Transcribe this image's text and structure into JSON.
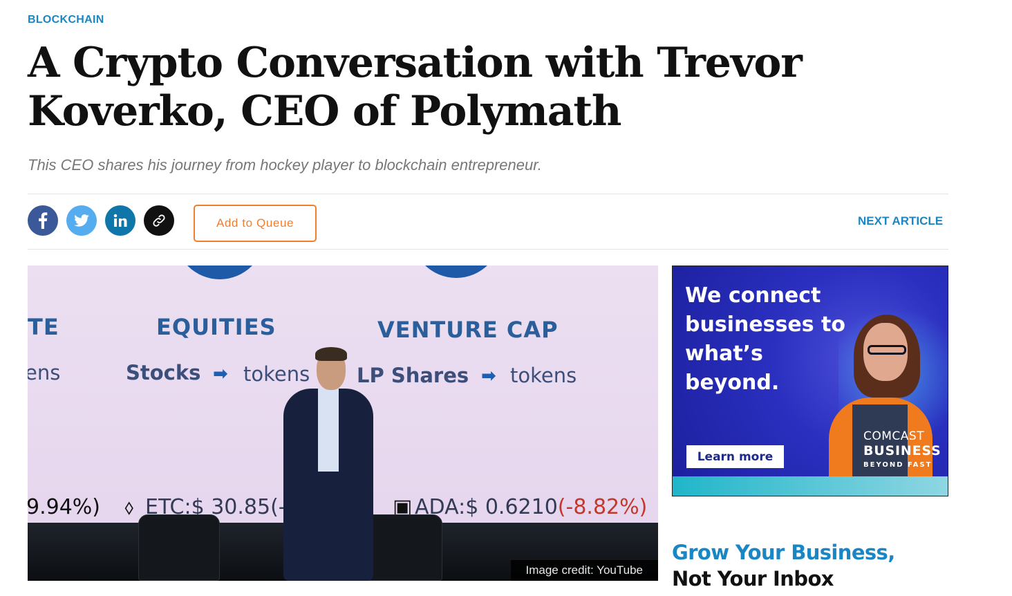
{
  "article": {
    "category": "BLOCKCHAIN",
    "headline": "A Crypto Conversation with Trevor Koverko, CEO of Polymath",
    "dek": "This CEO shares his journey from hockey player to blockchain entrepreneur."
  },
  "toolbar": {
    "share_icons": [
      "facebook-icon",
      "twitter-icon",
      "linkedin-icon",
      "link-icon"
    ],
    "queue_label": "Add to Queue",
    "next_label": "NEXT ARTICLE",
    "colors": {
      "facebook": "#3b5998",
      "twitter": "#55acee",
      "linkedin": "#0e76a8",
      "link": "#111111",
      "queue": "#f07e2f",
      "accent": "#1b86c4"
    }
  },
  "hero": {
    "slide": {
      "cat_left": "TE",
      "cat_equities": "EQUITIES",
      "cat_venture": "VENTURE CAP",
      "left_sub": "ens",
      "stocks": "Stocks",
      "tokens1": "tokens",
      "lp_shares": "LP Shares",
      "tokens2": "tokens",
      "ticker_left": "9.94%)",
      "ticker_etc": "ETC:$ 30.85(-",
      "ticker_ada_label": "ADA:$ 0.6210",
      "ticker_ada_change": "(-8.82%)"
    },
    "credit": "Image credit: YouTube"
  },
  "ad": {
    "headline": "We connect businesses to what’s beyond.",
    "cta": "Learn more",
    "brand_line1": "COMCAST",
    "brand_line2": "BUSINESS",
    "brand_line3": "BEYOND FAST"
  },
  "promo": {
    "line1": "Grow Your Business,",
    "line2": "Not Your Inbox"
  }
}
